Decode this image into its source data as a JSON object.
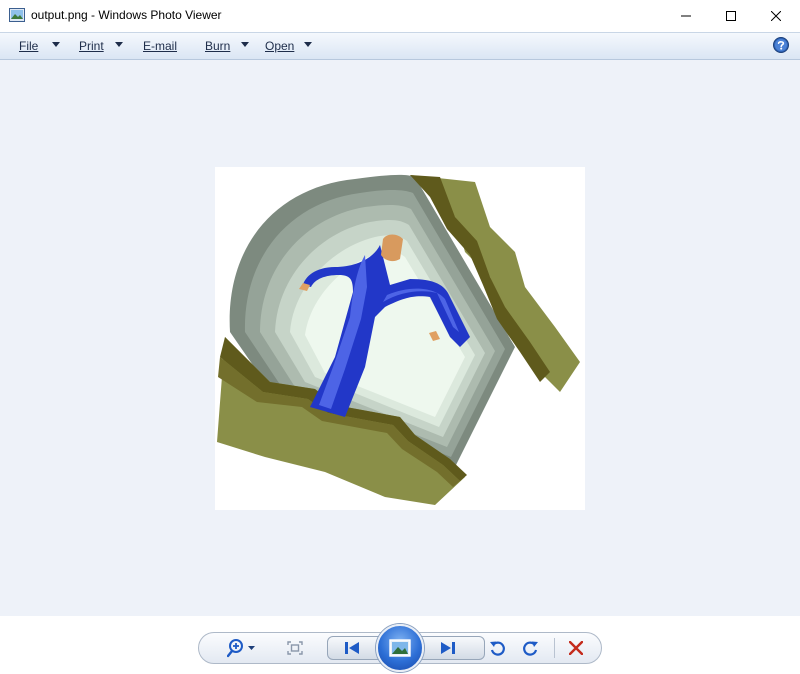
{
  "window": {
    "title": "output.png - Windows Photo Viewer",
    "controls": [
      "minimize-icon",
      "maximize-icon",
      "close-icon"
    ]
  },
  "menu": {
    "items": [
      {
        "label": "File",
        "has_dropdown": true
      },
      {
        "label": "Print",
        "has_dropdown": true
      },
      {
        "label": "E-mail",
        "has_dropdown": false
      },
      {
        "label": "Burn",
        "has_dropdown": true
      },
      {
        "label": "Open",
        "has_dropdown": true
      }
    ],
    "help_icon": "help-icon"
  },
  "toolbar": {
    "buttons": [
      "zoom-icon",
      "actual-size-icon",
      "previous-icon",
      "slideshow-icon",
      "next-icon",
      "rotate-counterclockwise-icon",
      "rotate-clockwise-icon",
      "delete-icon"
    ]
  },
  "colors": {
    "canvas_background": "#eef2f9",
    "menubar_top": "#f5f8fd",
    "menubar_bottom": "#dbe6f4",
    "accent_blue": "#1e5bc6",
    "delete_red": "#c42b1c"
  }
}
